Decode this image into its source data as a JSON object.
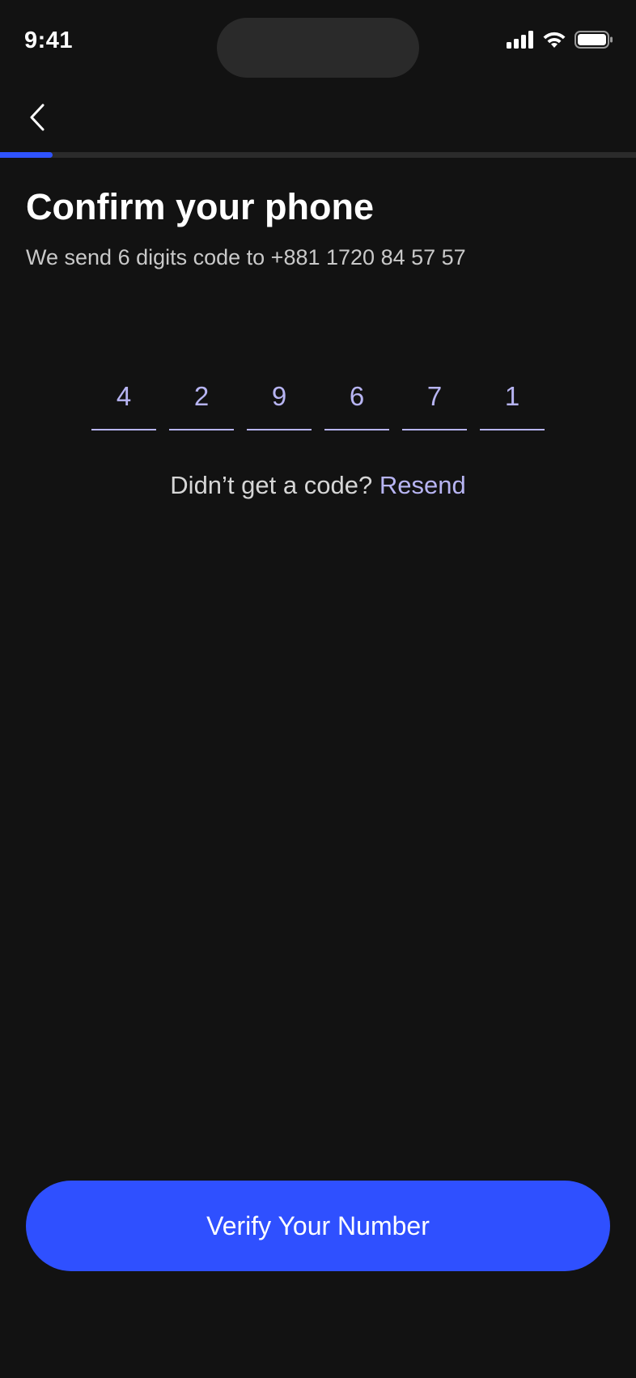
{
  "status_bar": {
    "time": "9:41",
    "icons": [
      "cellular-signal-icon",
      "wifi-icon",
      "battery-icon"
    ]
  },
  "nav": {
    "back_icon": "chevron-left-icon"
  },
  "progress": {
    "fraction": 0.083,
    "accent_color": "#2F53FF"
  },
  "header": {
    "title": "Confirm your phone",
    "subtitle": "We send 6 digits code to +881 1720 84 57 57"
  },
  "otp": {
    "digits": [
      "4",
      "2",
      "9",
      "6",
      "7",
      "1"
    ],
    "color": "#B7B4F2"
  },
  "resend": {
    "prompt": "Didn’t get a code?",
    "link_label": "Resend"
  },
  "cta": {
    "label": "Verify Your Number",
    "color": "#2F50FF"
  },
  "colors": {
    "background": "#121212",
    "text_primary": "#FFFFFF",
    "text_secondary": "#C9C9C9"
  }
}
